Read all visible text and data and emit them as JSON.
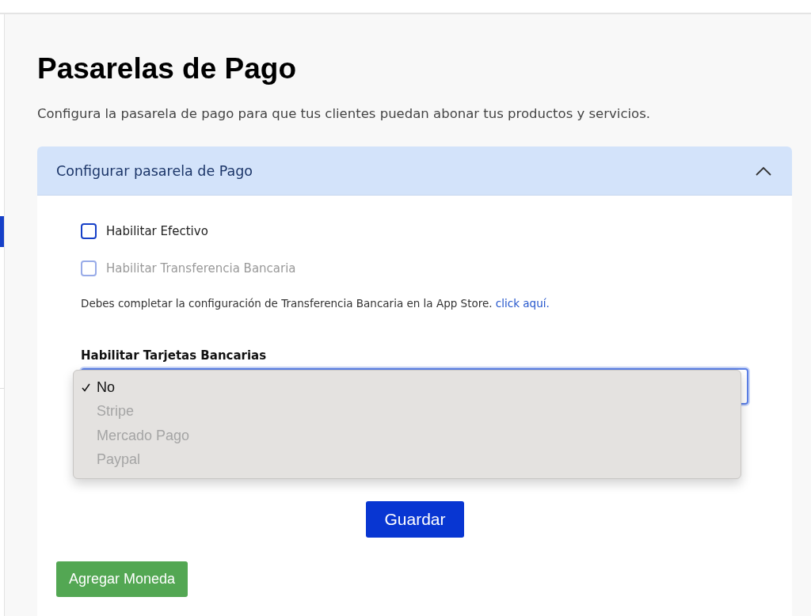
{
  "page": {
    "title": "Pasarelas de Pago",
    "description": "Configura la pasarela de pago para que tus clientes puedan abonar tus productos y servicios."
  },
  "sidebar": {
    "items": [
      {
        "selected": true
      }
    ]
  },
  "panel": {
    "title": "Configurar pasarela de Pago",
    "expanded": true,
    "checkboxes": [
      {
        "label": "Habilitar Efectivo",
        "checked": false,
        "disabled": false
      },
      {
        "label": "Habilitar Transferencia Bancaria",
        "checked": false,
        "disabled": true
      }
    ],
    "note": {
      "text": "Debes completar la configuración de Transferencia Bancaria en la App Store.",
      "link": "click aquí."
    },
    "cards_select": {
      "label": "Habilitar Tarjetas Bancarias",
      "expanded": true,
      "options": [
        {
          "label": "No",
          "selected": true,
          "disabled": false
        },
        {
          "label": "Stripe",
          "selected": false,
          "disabled": true
        },
        {
          "label": "Mercado Pago",
          "selected": false,
          "disabled": true
        },
        {
          "label": "Paypal",
          "selected": false,
          "disabled": true
        }
      ]
    },
    "save_button": "Guardar",
    "add_currency_button": "Agregar Moneda"
  }
}
